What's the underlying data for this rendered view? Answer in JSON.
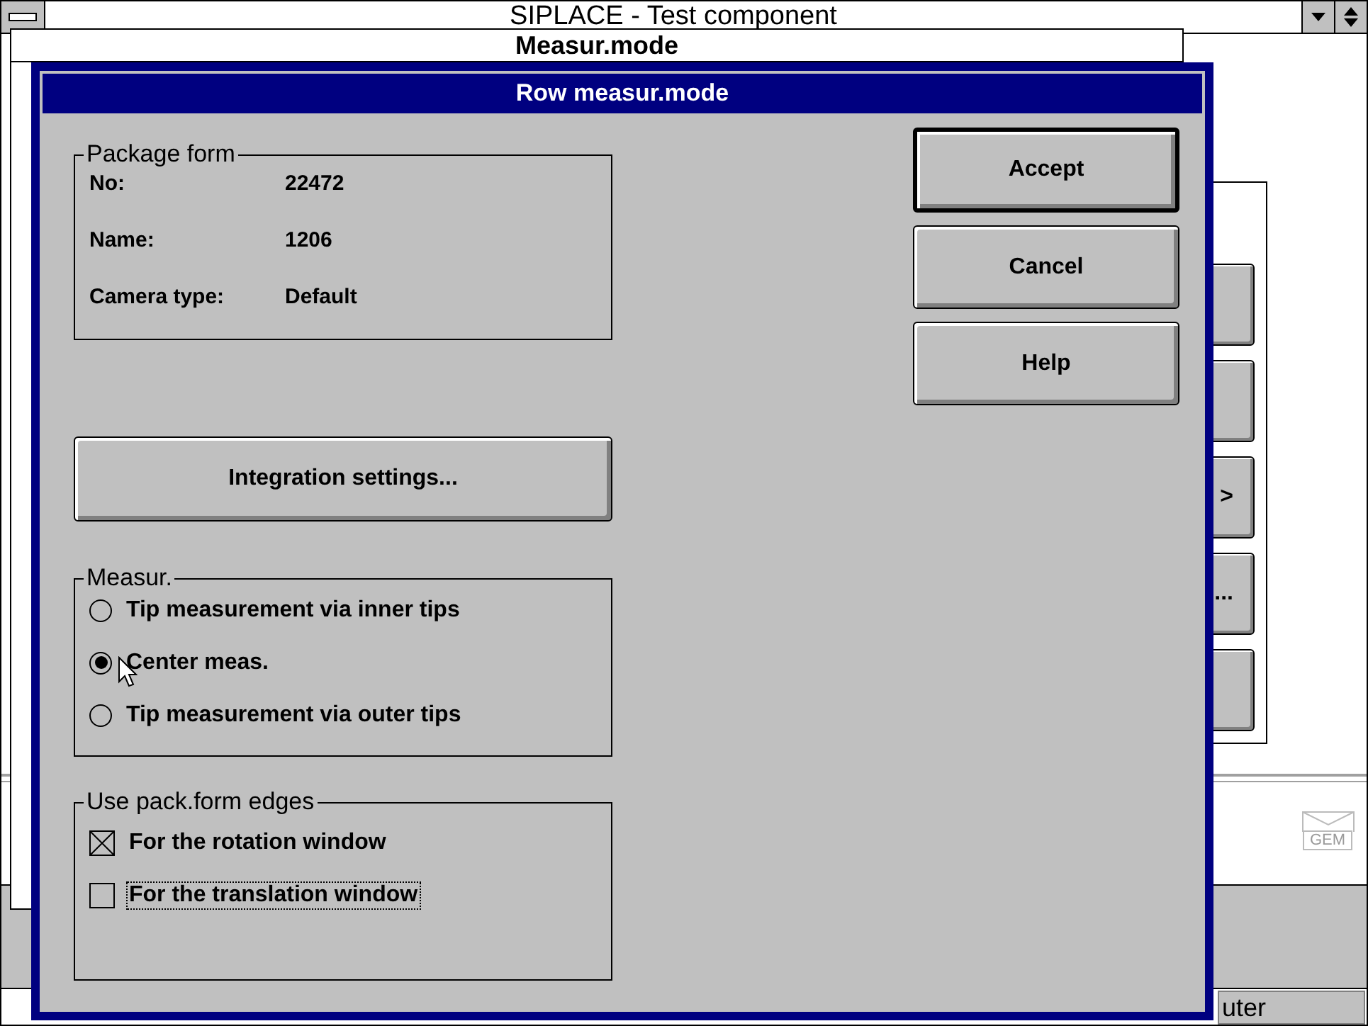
{
  "app_window": {
    "title": "SIPLACE - Test component",
    "status_text": "uter",
    "mail_icon_label": "GEM"
  },
  "back_window": {
    "title": "Measur.mode",
    "side_buttons": [
      {
        "kind": "blank"
      },
      {
        "kind": "blank"
      },
      {
        "kind": "labeled",
        "label": ">"
      },
      {
        "kind": "labeled",
        "label": "..."
      },
      {
        "kind": "blank"
      }
    ]
  },
  "dialog": {
    "title": "Row measur.mode",
    "package_form": {
      "title": "Package form",
      "fields": [
        {
          "label": "No:",
          "value": "22472"
        },
        {
          "label": "Name:",
          "value": "1206"
        },
        {
          "label": "Camera type:",
          "value": "Default"
        }
      ]
    },
    "integration_button": "Integration settings...",
    "measure": {
      "title": "Measur.",
      "options": [
        {
          "label": "Tip measurement via inner tips",
          "selected": false
        },
        {
          "label": "Center meas.",
          "selected": true
        },
        {
          "label": "Tip measurement via outer tips",
          "selected": false
        }
      ]
    },
    "edges": {
      "title": "Use pack.form edges",
      "checks": [
        {
          "label": "For the rotation window",
          "checked": true,
          "focused": false
        },
        {
          "label": "For the translation window",
          "checked": false,
          "focused": true
        }
      ]
    },
    "buttons": [
      {
        "label": "Accept",
        "default": true
      },
      {
        "label": "Cancel",
        "default": false
      },
      {
        "label": "Help",
        "default": false
      }
    ]
  }
}
